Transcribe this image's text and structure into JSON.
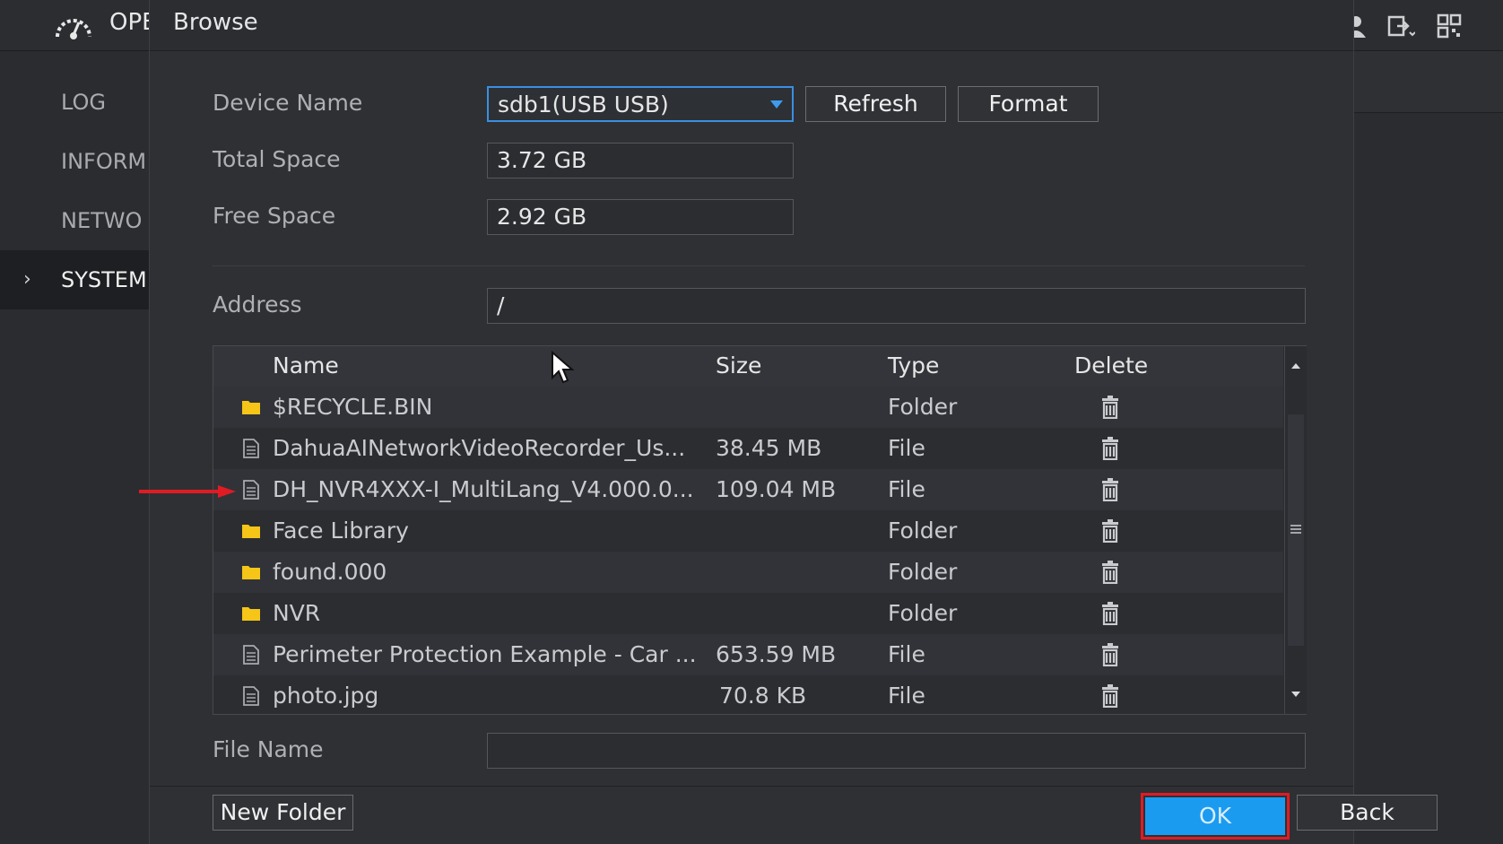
{
  "app": {
    "title": "OPE",
    "logo_icon": "speedometer-icon",
    "top_icons": [
      "user-icon",
      "logout-icon",
      "qr-code-icon"
    ]
  },
  "sidebar": {
    "items": [
      {
        "label": "LOG",
        "active": false
      },
      {
        "label": "INFORM",
        "active": false
      },
      {
        "label": "NETWO",
        "active": false
      },
      {
        "label": "SYSTEM",
        "active": true
      }
    ]
  },
  "dialog": {
    "title": "Browse",
    "device_name_label": "Device Name",
    "device_name_value": "sdb1(USB USB)",
    "refresh_label": "Refresh",
    "format_label": "Format",
    "total_space_label": "Total Space",
    "total_space_value": "3.72 GB",
    "free_space_label": "Free Space",
    "free_space_value": "2.92 GB",
    "address_label": "Address",
    "address_value": "/",
    "file_name_label": "File Name",
    "file_name_value": "",
    "new_folder_label": "New Folder",
    "ok_label": "OK",
    "back_label": "Back"
  },
  "table": {
    "columns": {
      "name": "Name",
      "size": "Size",
      "type": "Type",
      "delete": "Delete"
    },
    "rows": [
      {
        "icon": "folder-icon",
        "name": "$RECYCLE.BIN",
        "size": "",
        "type": "Folder"
      },
      {
        "icon": "file-icon",
        "name": "DahuaAINetworkVideoRecorder_Us...",
        "size": "38.45 MB",
        "type": "File"
      },
      {
        "icon": "file-icon",
        "name": "DH_NVR4XXX-I_MultiLang_V4.000.0...",
        "size": "109.04 MB",
        "type": "File"
      },
      {
        "icon": "folder-icon",
        "name": "Face Library",
        "size": "",
        "type": "Folder"
      },
      {
        "icon": "folder-icon",
        "name": "found.000",
        "size": "",
        "type": "Folder"
      },
      {
        "icon": "folder-icon",
        "name": "NVR",
        "size": "",
        "type": "Folder"
      },
      {
        "icon": "file-icon",
        "name": "Perimeter Protection Example - Car ...",
        "size": "653.59 MB",
        "type": "File"
      },
      {
        "icon": "file-icon",
        "name": "photo.jpg",
        "size": "70.8 KB",
        "type": "File"
      }
    ]
  },
  "colors": {
    "accent": "#1a9bf0",
    "highlight": "#e01b24",
    "folder": "#f5c518"
  }
}
